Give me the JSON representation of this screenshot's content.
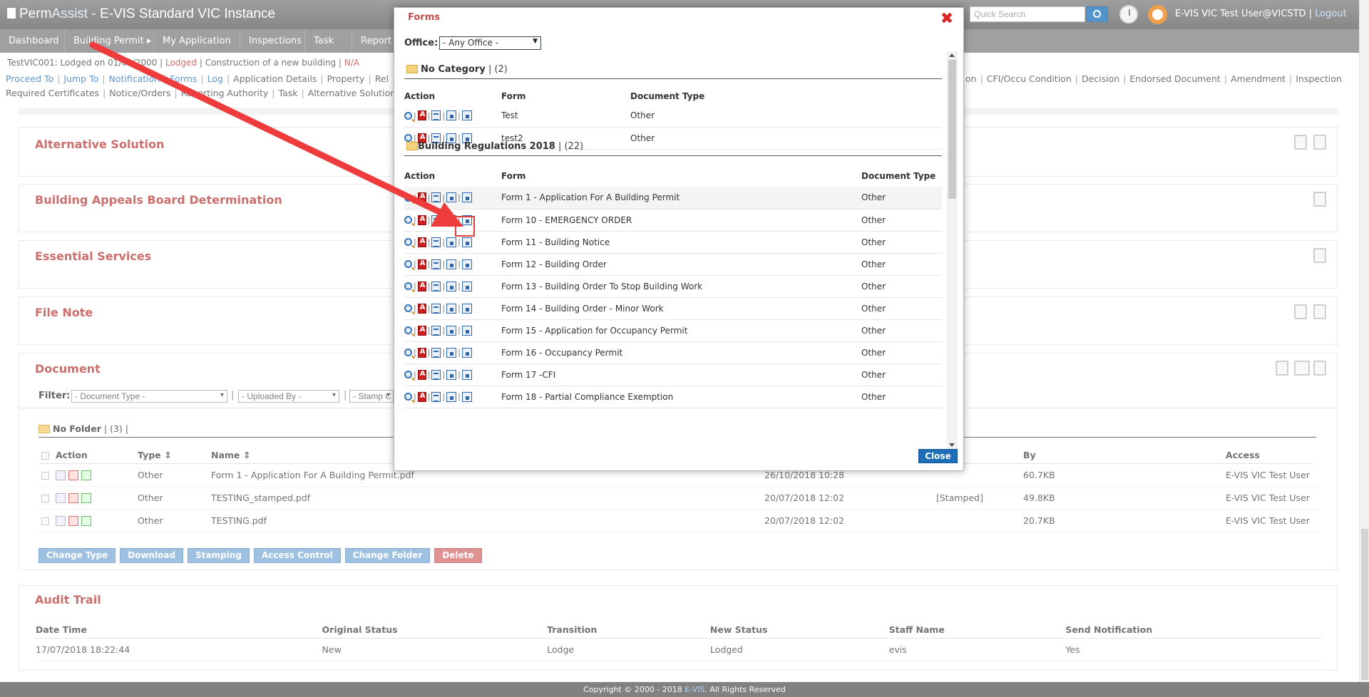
{
  "app": {
    "brand_perm": "Perm",
    "brand_assist": "Assist",
    "title": " - E-VIS Standard VIC Instance",
    "search_placeholder": "Quick Search",
    "user": "E-VIS VIC Test User@VICSTD",
    "sep": " | ",
    "logout": "Logout"
  },
  "nav": [
    "Dashboard",
    "Building Permit ▸",
    "My Application",
    "Inspections",
    "Task",
    "Report"
  ],
  "lodged": {
    "text": "TestVIC001: Lodged on 01/01/2000 | ",
    "status": "Lodged",
    "rest": " | Construction of a new building | ",
    "na": "N/A"
  },
  "links_row1_left": [
    {
      "t": "Proceed To",
      "c": "b"
    },
    {
      "t": "Jump To",
      "c": "b"
    },
    {
      "t": "Notification",
      "c": "b"
    },
    {
      "t": "Forms",
      "c": "b"
    },
    {
      "t": "Log",
      "c": "b"
    },
    {
      "t": "Application Details",
      "c": "g"
    },
    {
      "t": "Property",
      "c": "g"
    },
    {
      "t": "Rel",
      "c": "g"
    }
  ],
  "links_row1_right": [
    {
      "t": "on",
      "c": "g"
    },
    {
      "t": "CFI/Occu Condition",
      "c": "g"
    },
    {
      "t": "Decision",
      "c": "g"
    },
    {
      "t": "Endorsed Document",
      "c": "g"
    },
    {
      "t": "Amendment",
      "c": "g"
    },
    {
      "t": "Inspection",
      "c": "g"
    }
  ],
  "links_row2": [
    {
      "t": "Required Certificates",
      "c": "g"
    },
    {
      "t": "Notice/Orders",
      "c": "g"
    },
    {
      "t": "Reporting Authority",
      "c": "g"
    },
    {
      "t": "Task",
      "c": "g"
    },
    {
      "t": "Alternative Solution",
      "c": "g"
    }
  ],
  "panels": {
    "alt": "Alternative Solution",
    "appeals": "Building Appeals Board Determination",
    "essential": "Essential Services",
    "filenote": "File Note",
    "document": "Document",
    "audit": "Audit Trail"
  },
  "filter": {
    "label": "Filter:",
    "doc_type": "- Document Type -",
    "uploaded_by": "- Uploaded By -",
    "stamp": "- Stamp C"
  },
  "no_folder": {
    "name": "No Folder",
    "count": " | (3) |"
  },
  "doc_headers": {
    "action": "Action",
    "type": "Type ⇕",
    "name": "Name ⇕",
    "by": "By",
    "access": "Access"
  },
  "doc_rows": [
    {
      "type": "Other",
      "name": "Form 1 - Application For A Building Permit.pdf",
      "stamp": "",
      "date": "26/10/2018 10:28",
      "size": "60.7KB",
      "by": "E-VIS VIC Test User",
      "color": "blue"
    },
    {
      "type": "Other",
      "name": "TESTING_stamped.pdf",
      "stamp": "[Stamped]",
      "date": "20/07/2018 12:02",
      "size": "49.8KB",
      "by": "E-VIS VIC Test User",
      "color": "red"
    },
    {
      "type": "Other",
      "name": "TESTING.pdf",
      "stamp": "",
      "date": "20/07/2018 12:02",
      "size": "20.7KB",
      "by": "E-VIS VIC Test User",
      "color": "blue"
    }
  ],
  "doc_buttons": [
    "Change Type",
    "Download",
    "Stamping",
    "Access Control",
    "Change Folder",
    "Delete"
  ],
  "audit_headers": [
    "Date Time",
    "Original Status",
    "Transition",
    "New Status",
    "Staff Name",
    "Send Notification"
  ],
  "audit_row": [
    "17/07/2018 18:22:44",
    "New",
    "Lodge",
    "Lodged",
    "evis",
    "Yes"
  ],
  "footer": {
    "pre": "Copyright © 2000 - 2018 ",
    "brand": "E-VIS",
    "post": ". All Rights Reserved"
  },
  "modal": {
    "title": "Forms",
    "office_label": "Office:",
    "office_value": "- Any Office -",
    "close": "Close",
    "cat1": {
      "name": "No Category",
      "count": " | (2)"
    },
    "cat2": {
      "name": "Building Regulations 2018",
      "count": " | (22)"
    },
    "h_action": "Action",
    "h_form": "Form",
    "h_doctype": "Document Type",
    "h_doctype2": "Document Type",
    "rows1": [
      {
        "form": "Test",
        "type": "Other"
      },
      {
        "form": "test2",
        "type": "Other"
      }
    ],
    "rows2": [
      {
        "form": "Form 1 - Application For A Building Permit",
        "type": "Other"
      },
      {
        "form": "Form 10 - EMERGENCY ORDER",
        "type": "Other"
      },
      {
        "form": "Form 11 - Building Notice",
        "type": "Other"
      },
      {
        "form": "Form 12 - Building Order",
        "type": "Other"
      },
      {
        "form": "Form 13 - Building Order To Stop Building Work",
        "type": "Other"
      },
      {
        "form": "Form 14 - Building Order - Minor Work",
        "type": "Other"
      },
      {
        "form": "Form 15 - Application for Occupancy Permit",
        "type": "Other"
      },
      {
        "form": "Form 16 - Occupancy Permit",
        "type": "Other"
      },
      {
        "form": "Form 17 -CFI",
        "type": "Other"
      },
      {
        "form": "Form 18 - Partial Compliance Exemption",
        "type": "Other"
      }
    ]
  },
  "colors": {
    "accent": "#c0504d",
    "link": "#3b7ec4",
    "arrow": "#ee3b3b"
  }
}
